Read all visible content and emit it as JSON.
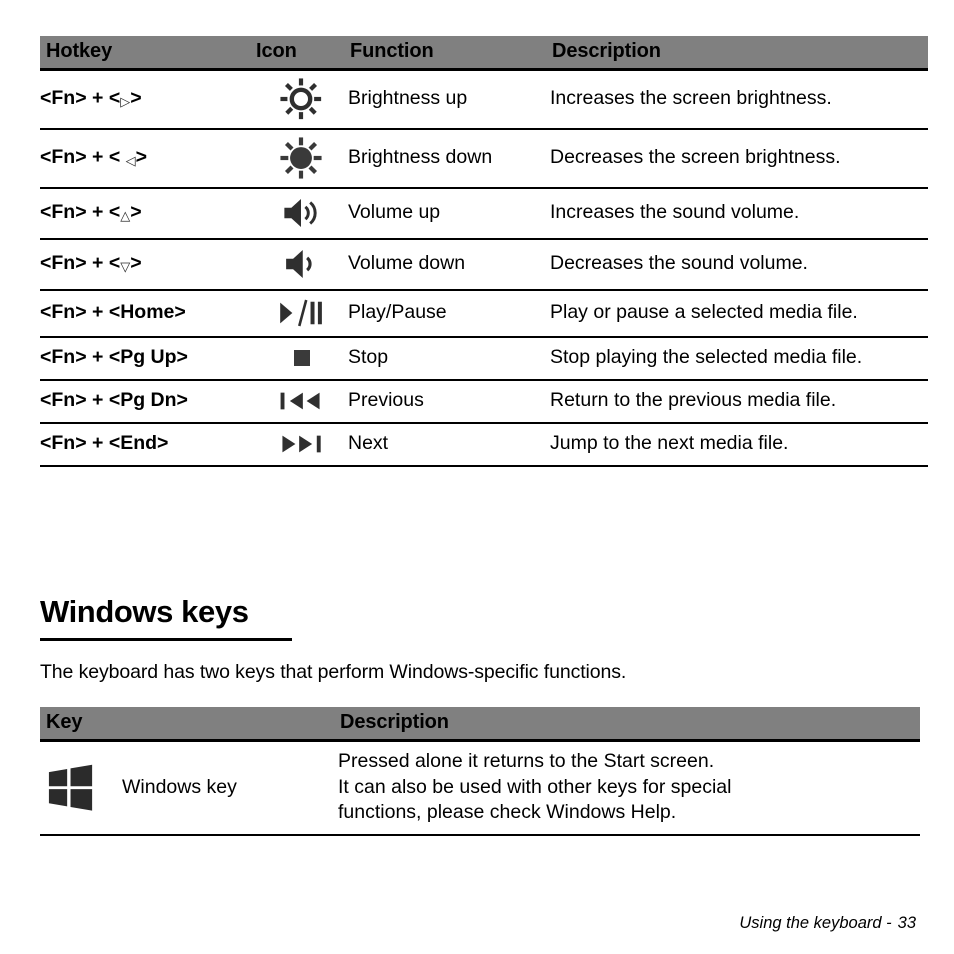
{
  "hotkey_table": {
    "columns": [
      "Hotkey",
      "Icon",
      "Function",
      "Description"
    ],
    "rows": [
      {
        "hotkey_prefix": "<Fn> + <",
        "hotkey_arrow": "▷",
        "hotkey_suffix": ">",
        "hotkey_full": "<Fn> + <▷>",
        "icon": "brightness-up-icon",
        "function": "Brightness up",
        "description": "Increases the screen brightness."
      },
      {
        "hotkey_prefix": "<Fn> + < ",
        "hotkey_arrow": "◁",
        "hotkey_suffix": ">",
        "hotkey_full": "<Fn> + <◁>",
        "icon": "brightness-down-icon",
        "function": "Brightness down",
        "description": "Decreases the screen brightness."
      },
      {
        "hotkey_prefix": "<Fn> + <",
        "hotkey_arrow": "△",
        "hotkey_suffix": ">",
        "hotkey_full": "<Fn> + <△>",
        "icon": "volume-up-icon",
        "function": "Volume up",
        "description": "Increases the sound volume."
      },
      {
        "hotkey_prefix": "<Fn> + <",
        "hotkey_arrow": "▽",
        "hotkey_suffix": ">",
        "hotkey_full": "<Fn> + <▽>",
        "icon": "volume-down-icon",
        "function": "Volume down",
        "description": "Decreases the sound volume."
      },
      {
        "hotkey_full": "<Fn> + <Home>",
        "icon": "play-pause-icon",
        "icon_glyph": "▶/❙❙",
        "function": "Play/Pause",
        "description": "Play or pause a selected media file."
      },
      {
        "hotkey_full": "<Fn> + <Pg Up>",
        "icon": "stop-icon",
        "icon_glyph": "■",
        "function": "Stop",
        "description": "Stop playing the selected media file."
      },
      {
        "hotkey_full": "<Fn> + <Pg Dn>",
        "icon": "previous-icon",
        "icon_glyph": "❙◀◀",
        "function": "Previous",
        "description": "Return to the previous media file."
      },
      {
        "hotkey_full": "<Fn> + <End>",
        "icon": "next-icon",
        "icon_glyph": "▶▶❙",
        "function": "Next",
        "description": "Jump to the next media file."
      }
    ]
  },
  "windows_section": {
    "heading": "Windows keys",
    "intro": "The keyboard has two keys that perform Windows-specific functions.",
    "table": {
      "columns": [
        "Key",
        "Description"
      ],
      "rows": [
        {
          "icon": "windows-logo-icon",
          "key_label": "Windows key",
          "description_lines": [
            "Pressed alone it returns to the Start screen.",
            "It can also be used with other keys for special",
            "functions, please check Windows Help."
          ]
        }
      ]
    }
  },
  "footer": {
    "section": "Using the keyboard -",
    "page": "33"
  },
  "colors": {
    "header_background": "#808080",
    "text": "#000000",
    "icon": "#2f2f2f",
    "rule": "#000000"
  }
}
